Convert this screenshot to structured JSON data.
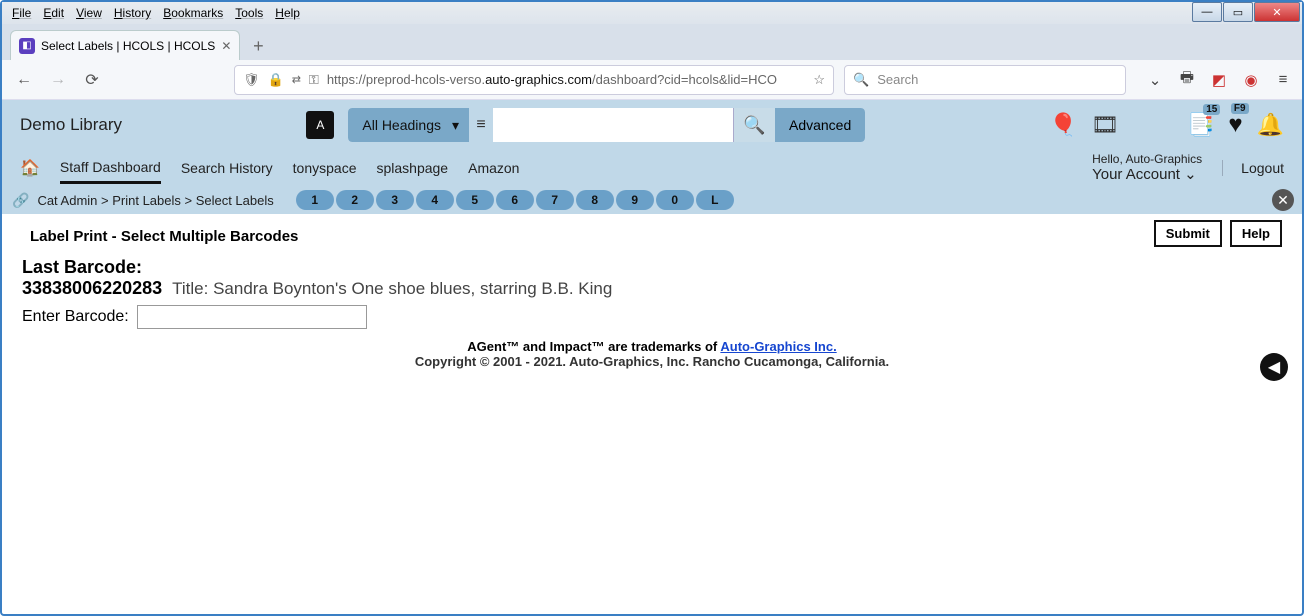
{
  "browser": {
    "menus": [
      "File",
      "Edit",
      "View",
      "History",
      "Bookmarks",
      "Tools",
      "Help"
    ],
    "tab_title": "Select Labels | HCOLS | HCOLS",
    "url_prefix": "https://preprod-hcols-verso.",
    "url_dark": "auto-graphics.com",
    "url_suffix": "/dashboard?cid=hcols&lid=HCO",
    "search_placeholder": "Search"
  },
  "app": {
    "library_name": "Demo Library",
    "headings_label": "All Headings",
    "advanced_label": "Advanced",
    "badge_count": "15",
    "badge_fn": "F9",
    "nav": [
      "Staff Dashboard",
      "Search History",
      "tonyspace",
      "splashpage",
      "Amazon"
    ],
    "hello": "Hello, Auto-Graphics",
    "account": "Your Account",
    "logout": "Logout"
  },
  "crumbs": {
    "text": "Cat Admin  >  Print Labels  >  Select Labels",
    "pills": [
      "1",
      "2",
      "3",
      "4",
      "5",
      "6",
      "7",
      "8",
      "9",
      "0",
      "L"
    ]
  },
  "page": {
    "heading": "Label Print - Select Multiple Barcodes",
    "submit": "Submit",
    "help": "Help",
    "last_barcode_label": "Last Barcode:",
    "last_barcode_value": "33838006220283",
    "title_text": "Title: Sandra Boynton's One shoe blues, starring B.B. King",
    "enter_label": "Enter Barcode:"
  },
  "footer": {
    "tm_prefix": "AGent™ and Impact™ are trademarks of ",
    "tm_link": "Auto-Graphics Inc.",
    "copyright": "Copyright © 2001 - 2021. Auto-Graphics, Inc. Rancho Cucamonga, California."
  }
}
